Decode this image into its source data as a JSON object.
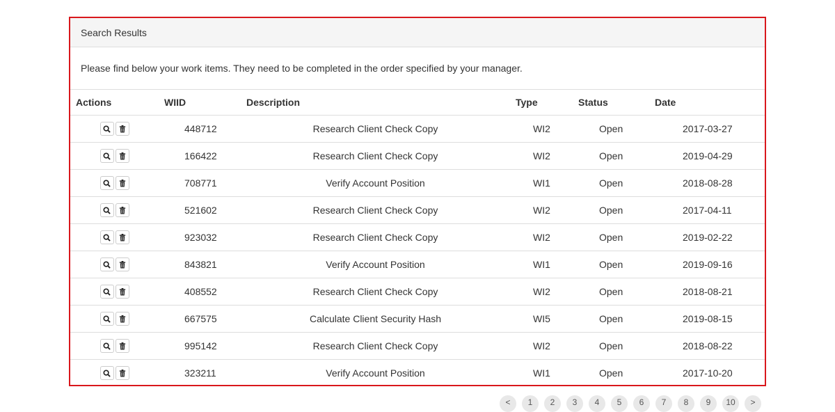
{
  "panel": {
    "heading": "Search Results",
    "intro": "Please find below your work items. They need to be completed in the order specified by your manager."
  },
  "table": {
    "headers": {
      "actions": "Actions",
      "wiid": "WIID",
      "description": "Description",
      "type": "Type",
      "status": "Status",
      "date": "Date"
    },
    "rows": [
      {
        "wiid": "448712",
        "description": "Research Client Check Copy",
        "type": "WI2",
        "status": "Open",
        "date": "2017-03-27"
      },
      {
        "wiid": "166422",
        "description": "Research Client Check Copy",
        "type": "WI2",
        "status": "Open",
        "date": "2019-04-29"
      },
      {
        "wiid": "708771",
        "description": "Verify Account Position",
        "type": "WI1",
        "status": "Open",
        "date": "2018-08-28"
      },
      {
        "wiid": "521602",
        "description": "Research Client Check Copy",
        "type": "WI2",
        "status": "Open",
        "date": "2017-04-11"
      },
      {
        "wiid": "923032",
        "description": "Research Client Check Copy",
        "type": "WI2",
        "status": "Open",
        "date": "2019-02-22"
      },
      {
        "wiid": "843821",
        "description": "Verify Account Position",
        "type": "WI1",
        "status": "Open",
        "date": "2019-09-16"
      },
      {
        "wiid": "408552",
        "description": "Research Client Check Copy",
        "type": "WI2",
        "status": "Open",
        "date": "2018-08-21"
      },
      {
        "wiid": "667575",
        "description": "Calculate Client Security Hash",
        "type": "WI5",
        "status": "Open",
        "date": "2019-08-15"
      },
      {
        "wiid": "995142",
        "description": "Research Client Check Copy",
        "type": "WI2",
        "status": "Open",
        "date": "2018-08-22"
      },
      {
        "wiid": "323211",
        "description": "Verify Account Position",
        "type": "WI1",
        "status": "Open",
        "date": "2017-10-20"
      }
    ],
    "row_actions": [
      "search-icon",
      "trash-icon"
    ]
  },
  "pagination": {
    "items": [
      "<",
      "1",
      "2",
      "3",
      "4",
      "5",
      "6",
      "7",
      "8",
      "9",
      "10",
      ">"
    ]
  },
  "colors": {
    "panel_border": "#d9171c",
    "heading_bg": "#f5f5f5",
    "row_border": "#dddddd"
  }
}
